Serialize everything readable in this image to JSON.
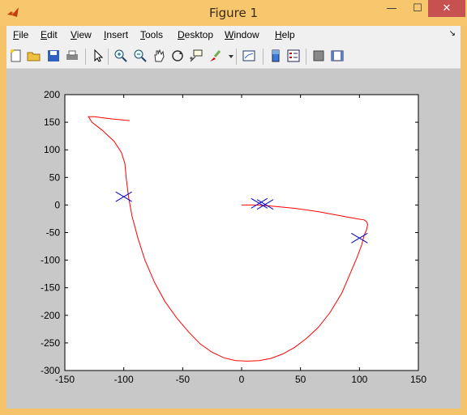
{
  "window": {
    "title": "Figure 1",
    "controls": {
      "minimize": "—",
      "maximize": "☐",
      "close": "✕"
    }
  },
  "menubar": {
    "items": [
      {
        "label": "File",
        "accel": "F",
        "rest": "ile"
      },
      {
        "label": "Edit",
        "accel": "E",
        "rest": "dit"
      },
      {
        "label": "View",
        "accel": "V",
        "rest": "iew"
      },
      {
        "label": "Insert",
        "accel": "I",
        "rest": "nsert"
      },
      {
        "label": "Tools",
        "accel": "T",
        "rest": "ools"
      },
      {
        "label": "Desktop",
        "accel": "D",
        "rest": "esktop"
      },
      {
        "label": "Window",
        "accel": "W",
        "rest": "indow"
      },
      {
        "label": "Help",
        "accel": "H",
        "rest": "elp"
      }
    ],
    "dock_arrow": "↘"
  },
  "toolbar": {
    "icons": [
      "new-figure-icon",
      "open-file-icon",
      "save-icon",
      "print-icon",
      "edit-plot-icon",
      "zoom-in-icon",
      "zoom-out-icon",
      "pan-icon",
      "rotate-3d-icon",
      "data-cursor-icon",
      "brush-icon",
      "brush-dropdown-icon",
      "link-plot-icon",
      "insert-colorbar-icon",
      "insert-legend-icon",
      "hide-plot-tools-icon",
      "show-plot-tools-icon"
    ]
  },
  "colors": {
    "curve": "#ff0000",
    "markers": "#0000cc"
  },
  "chart_data": {
    "type": "line",
    "title": "",
    "xlabel": "",
    "ylabel": "",
    "xlim": [
      -150,
      150
    ],
    "ylim": [
      -300,
      200
    ],
    "xticks": [
      -150,
      -100,
      -50,
      0,
      50,
      100,
      150
    ],
    "yticks": [
      -300,
      -250,
      -200,
      -150,
      -100,
      -50,
      0,
      50,
      100,
      150,
      200
    ],
    "grid": false,
    "series": [
      {
        "style": "red-line",
        "x": [
          -95,
          -110,
          -125,
          -130,
          -127,
          -118,
          -108,
          -102,
          -99,
          -98,
          -96,
          -93,
          -88,
          -82,
          -74,
          -65,
          -55,
          -45,
          -35,
          -25,
          -15,
          -5,
          5,
          15,
          25,
          35,
          45,
          55,
          65,
          75,
          85,
          92,
          98,
          102,
          104,
          106,
          107,
          106,
          104,
          98,
          85,
          65,
          45,
          30,
          20,
          10,
          0
        ],
        "y": [
          153,
          156,
          160,
          160,
          150,
          135,
          115,
          95,
          75,
          50,
          15,
          -20,
          -60,
          -100,
          -140,
          -175,
          -205,
          -230,
          -252,
          -267,
          -277,
          -282,
          -283,
          -282,
          -278,
          -270,
          -258,
          -242,
          -222,
          -195,
          -160,
          -125,
          -95,
          -72,
          -55,
          -45,
          -35,
          -30,
          -27,
          -25,
          -20,
          -12,
          -6,
          -3,
          -1,
          0,
          0
        ]
      },
      {
        "style": "blue-x-markers",
        "x": [
          -100,
          15,
          20,
          100
        ],
        "y": [
          15,
          3,
          1,
          -60
        ]
      }
    ]
  }
}
